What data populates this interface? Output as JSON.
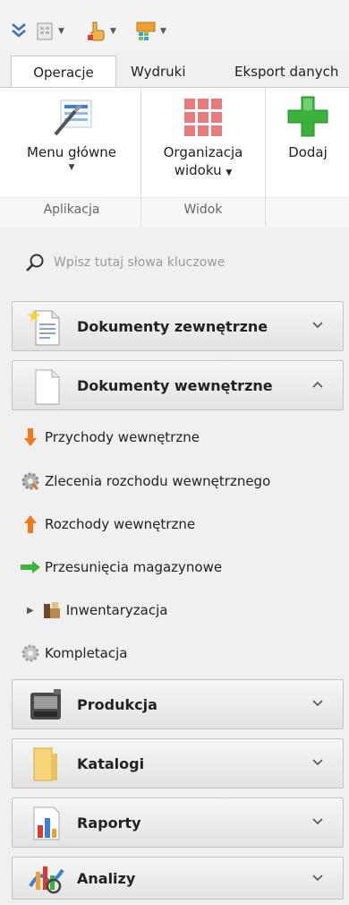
{
  "tabs": [
    {
      "label": "Operacje",
      "active": true
    },
    {
      "label": "Wydruki",
      "active": false
    },
    {
      "label": "Eksport danych",
      "active": false
    }
  ],
  "ribbon": {
    "buttons": [
      {
        "label_line1": "Menu główne",
        "label_line2": "",
        "has_dropdown": true,
        "icon": "main-menu-icon"
      },
      {
        "label_line1": "Organizacja",
        "label_line2": "widoku",
        "has_dropdown": true,
        "icon": "grid-view-icon"
      },
      {
        "label_line1": "Dodaj",
        "label_line2": "",
        "has_dropdown": false,
        "icon": "plus-icon"
      }
    ],
    "groups": [
      {
        "label": "Aplikacja"
      },
      {
        "label": "Widok"
      }
    ]
  },
  "search": {
    "placeholder": "Wpisz tutaj słowa kluczowe"
  },
  "sections": [
    {
      "title": "Dokumenty zewnętrzne",
      "expanded": false,
      "icon": "external-documents-icon"
    },
    {
      "title": "Dokumenty wewnętrzne",
      "expanded": true,
      "icon": "internal-documents-icon"
    },
    {
      "title": "Produkcja",
      "expanded": false,
      "icon": "production-icon"
    },
    {
      "title": "Katalogi",
      "expanded": false,
      "icon": "folder-icon"
    },
    {
      "title": "Raporty",
      "expanded": false,
      "icon": "report-chart-icon"
    },
    {
      "title": "Analizy",
      "expanded": false,
      "icon": "analysis-icon"
    }
  ],
  "internal_items": [
    {
      "label": "Przychody wewnętrzne",
      "icon": "arrow-down-icon"
    },
    {
      "label": "Zlecenia rozchodu wewnętrznego",
      "icon": "gear-icon"
    },
    {
      "label": "Rozchody wewnętrzne",
      "icon": "arrow-up-icon"
    },
    {
      "label": "Przesunięcia magazynowe",
      "icon": "arrow-right-icon"
    },
    {
      "label": "Inwentaryzacja",
      "icon": "inventory-icon",
      "expandable": true
    },
    {
      "label": "Kompletacja",
      "icon": "gear-icon"
    }
  ],
  "colors": {
    "accent_orange": "#f07a1a",
    "plus_green": "#3bb23b",
    "tiles_red": "#e86b6b"
  }
}
